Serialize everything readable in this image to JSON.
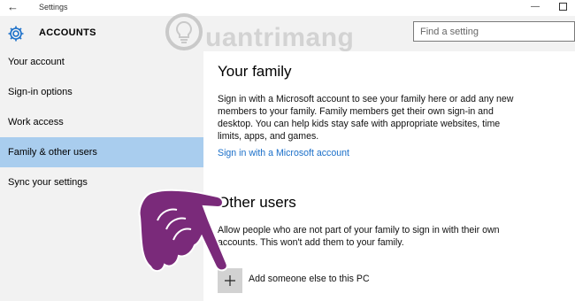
{
  "window": {
    "title": "Settings"
  },
  "header": {
    "title": "ACCOUNTS",
    "search_placeholder": "Find a setting"
  },
  "sidebar": {
    "items": [
      {
        "label": "Your account",
        "active": false
      },
      {
        "label": "Sign-in options",
        "active": false
      },
      {
        "label": "Work access",
        "active": false
      },
      {
        "label": "Family & other users",
        "active": true
      },
      {
        "label": "Sync your settings",
        "active": false
      }
    ]
  },
  "family": {
    "heading": "Your family",
    "description": "Sign in with a Microsoft account to see your family here or add any new members to your family. Family members get their own sign-in and desktop. You can help kids stay safe with appropriate websites, time limits, apps, and games.",
    "link": "Sign in with a Microsoft account"
  },
  "other_users": {
    "heading": "Other users",
    "description": "Allow people who are not part of your family to sign in with their own accounts. This won't add them to your family.",
    "add_label": "Add someone else to this PC"
  },
  "watermark": {
    "text": "uantrimang"
  },
  "colors": {
    "accent": "#1a6fc9",
    "selected": "#a9cdee",
    "pane": "#f2f2f2",
    "hand": "#7a2a7a"
  }
}
